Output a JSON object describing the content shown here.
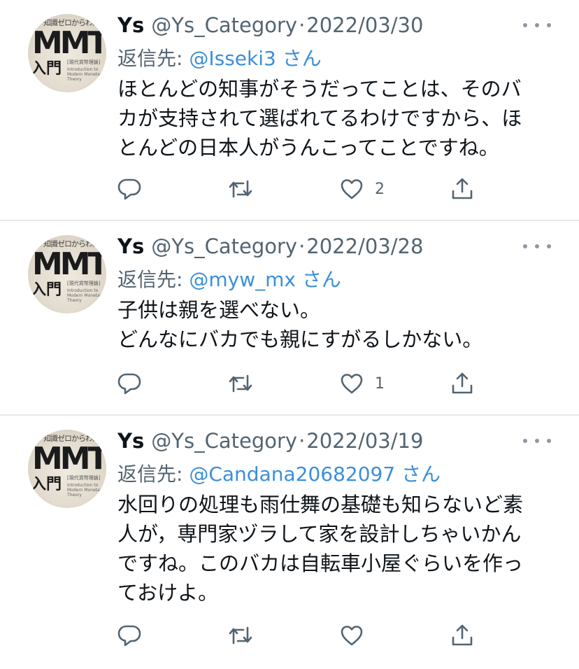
{
  "tweets": [
    {
      "name": "Ys",
      "handle": "@Ys_Category",
      "separator": "·",
      "date": "2022/03/30",
      "reply_label": "返信先: ",
      "reply_target": "@Isseki3",
      "reply_suffix": " さん",
      "lines": [
        "ほとんどの知事がそうだってことは、そのバ",
        "カが支持されて選ばれてるわけですから、ほ",
        "とんどの日本人がうんこってことですね。"
      ],
      "like_count": "2"
    },
    {
      "name": "Ys",
      "handle": "@Ys_Category",
      "separator": "·",
      "date": "2022/03/28",
      "reply_label": "返信先: ",
      "reply_target": "@myw_mx",
      "reply_suffix": " さん",
      "lines": [
        "子供は親を選べない。",
        "どんなにバカでも親にすがるしかない。"
      ],
      "like_count": "1"
    },
    {
      "name": "Ys",
      "handle": "@Ys_Category",
      "separator": "·",
      "date": "2022/03/19",
      "reply_label": "返信先: ",
      "reply_target": "@Candana20682097",
      "reply_suffix": " さん",
      "lines": [
        "水回りの処理も雨仕舞の基礎も知らないど素",
        "人が，専門家ヅラして家を設計しちゃいかん",
        "ですね。このバカは自転車小屋ぐらいを作っ",
        "ておけよ。"
      ],
      "like_count": ""
    }
  ],
  "avatar": {
    "top_text": "知識ゼロからわかる",
    "title": "MMT",
    "subtitle": "入門",
    "small_jp": "[現代貨幣理論]",
    "small_en": "Introduction to Modern Monetary Theory"
  },
  "icons": {
    "reply": "reply-icon",
    "retweet": "retweet-icon",
    "like": "heart-icon",
    "share": "share-icon",
    "more": "more-icon"
  },
  "colors": {
    "link": "#3b8fd9",
    "secondary": "#536471",
    "divider": "#e6e8ea"
  }
}
